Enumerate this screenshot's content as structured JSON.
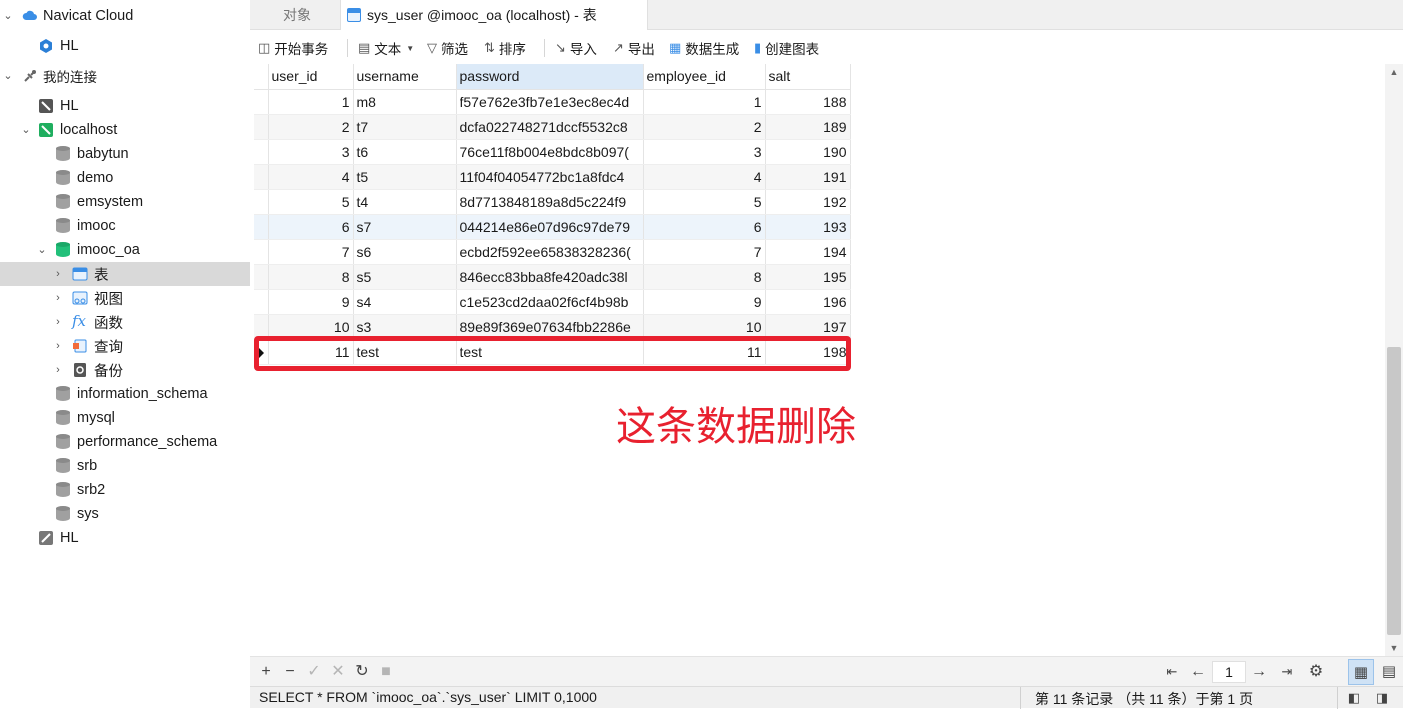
{
  "sidebar": {
    "items": [
      {
        "label": "Navicat Cloud",
        "icon": "cloud-icon",
        "chevron": "down"
      },
      {
        "label": "HL",
        "icon": "hex-icon"
      },
      {
        "label": "我的连接",
        "icon": "connection-group-icon",
        "chevron": "down"
      },
      {
        "label": "HL",
        "icon": "mysql-server-icon"
      },
      {
        "label": "localhost",
        "icon": "mysql-server-connected-icon",
        "chevron": "down"
      },
      {
        "label": "babytun",
        "icon": "database-icon"
      },
      {
        "label": "demo",
        "icon": "database-icon"
      },
      {
        "label": "emsystem",
        "icon": "database-icon"
      },
      {
        "label": "imooc",
        "icon": "database-icon"
      },
      {
        "label": "imooc_oa",
        "icon": "database-open-icon",
        "chevron": "down"
      },
      {
        "label": "表",
        "icon": "table-icon",
        "chevron": "right",
        "selected": true
      },
      {
        "label": "视图",
        "icon": "view-icon",
        "chevron": "right"
      },
      {
        "label": "函数",
        "icon": "function-icon",
        "chevron": "right"
      },
      {
        "label": "查询",
        "icon": "query-icon",
        "chevron": "right"
      },
      {
        "label": "备份",
        "icon": "backup-icon",
        "chevron": "right"
      },
      {
        "label": "information_schema",
        "icon": "database-icon"
      },
      {
        "label": "mysql",
        "icon": "database-icon"
      },
      {
        "label": "performance_schema",
        "icon": "database-icon"
      },
      {
        "label": "srb",
        "icon": "database-icon"
      },
      {
        "label": "srb2",
        "icon": "database-icon"
      },
      {
        "label": "sys",
        "icon": "database-icon"
      },
      {
        "label": "HL",
        "icon": "mysql-server-alt-icon"
      }
    ]
  },
  "tabs": [
    {
      "label": "对象",
      "active": false
    },
    {
      "label": "sys_user @imooc_oa (localhost) - 表",
      "active": true
    }
  ],
  "toolbar": {
    "begin_tx": "开始事务",
    "text": "文本",
    "filter": "筛选",
    "sort": "排序",
    "import": "导入",
    "export": "导出",
    "data_gen": "数据生成",
    "create_chart": "创建图表"
  },
  "grid": {
    "columns": [
      "user_id",
      "username",
      "password",
      "employee_id",
      "salt"
    ],
    "rows": [
      [
        "1",
        "m8",
        "f57e762e3fb7e1e3ec8ec4d",
        "1",
        "188"
      ],
      [
        "2",
        "t7",
        "dcfa022748271dccf5532c8",
        "2",
        "189"
      ],
      [
        "3",
        "t6",
        "76ce11f8b004e8bdc8b097(",
        "3",
        "190"
      ],
      [
        "4",
        "t5",
        "11f04f04054772bc1a8fdc4",
        "4",
        "191"
      ],
      [
        "5",
        "t4",
        "8d7713848189a8d5c224f9",
        "5",
        "192"
      ],
      [
        "6",
        "s7",
        "044214e86e07d96c97de79",
        "6",
        "193"
      ],
      [
        "7",
        "s6",
        "ecbd2f592ee65838328236(",
        "7",
        "194"
      ],
      [
        "8",
        "s5",
        "846ecc83bba8fe420adc38l",
        "8",
        "195"
      ],
      [
        "9",
        "s4",
        "c1e523cd2daa02f6cf4b98b",
        "9",
        "196"
      ],
      [
        "10",
        "s3",
        "89e89f369e07634fbb2286e",
        "10",
        "197"
      ],
      [
        "11",
        "test",
        "test",
        "11",
        "198"
      ]
    ]
  },
  "annotation": "这条数据删除",
  "pager": {
    "page": "1"
  },
  "status": {
    "sql": "SELECT * FROM `imooc_oa`.`sys_user` LIMIT 0,1000",
    "records": "第 11 条记录 （共 11 条）于第 1 页"
  },
  "colors": {
    "accent": "#3a8ee6",
    "annotation": "#e8212f",
    "selected_row": "#d9d9d9"
  }
}
